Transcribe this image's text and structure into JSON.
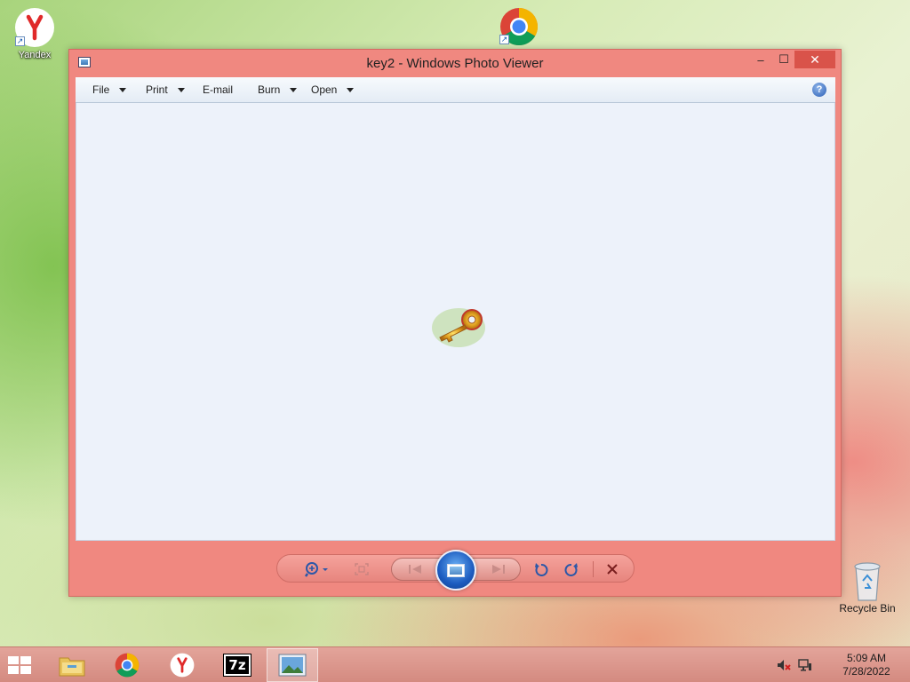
{
  "desktop": {
    "icons": [
      {
        "label": "Yandex"
      },
      {
        "label": ""
      },
      {
        "label": "Recycle Bin"
      }
    ]
  },
  "window": {
    "title": "key2 - Windows Photo Viewer",
    "controls": {
      "minimize": "–",
      "maximize": "☐",
      "close": "✕"
    }
  },
  "menubar": {
    "items": [
      {
        "label": "File",
        "has_dropdown": true
      },
      {
        "label": "Print",
        "has_dropdown": true
      },
      {
        "label": "E-mail",
        "has_dropdown": false
      },
      {
        "label": "Burn",
        "has_dropdown": true
      },
      {
        "label": "Open",
        "has_dropdown": true
      }
    ],
    "help_icon": "?"
  },
  "viewer": {
    "image_name": "key2",
    "image_icon": "golden-key-icon"
  },
  "controlbar": {
    "buttons": [
      "zoom-icon",
      "actual-size-icon",
      "previous-icon",
      "slideshow-icon",
      "next-icon",
      "rotate-counterclockwise-icon",
      "rotate-clockwise-icon",
      "delete-icon"
    ]
  },
  "taskbar": {
    "apps": [
      "file-explorer-icon",
      "chrome-icon",
      "yandex-icon",
      "7zip-icon",
      "photo-viewer-icon"
    ],
    "active_app": "photo-viewer-icon",
    "seven_zip_label": "7z",
    "clock": {
      "time": "5:09 AM",
      "date": "7/28/2022"
    }
  },
  "colors": {
    "window_accent": "#f08880",
    "viewer_background": "#edf2fa",
    "close_button": "#d9534a"
  }
}
